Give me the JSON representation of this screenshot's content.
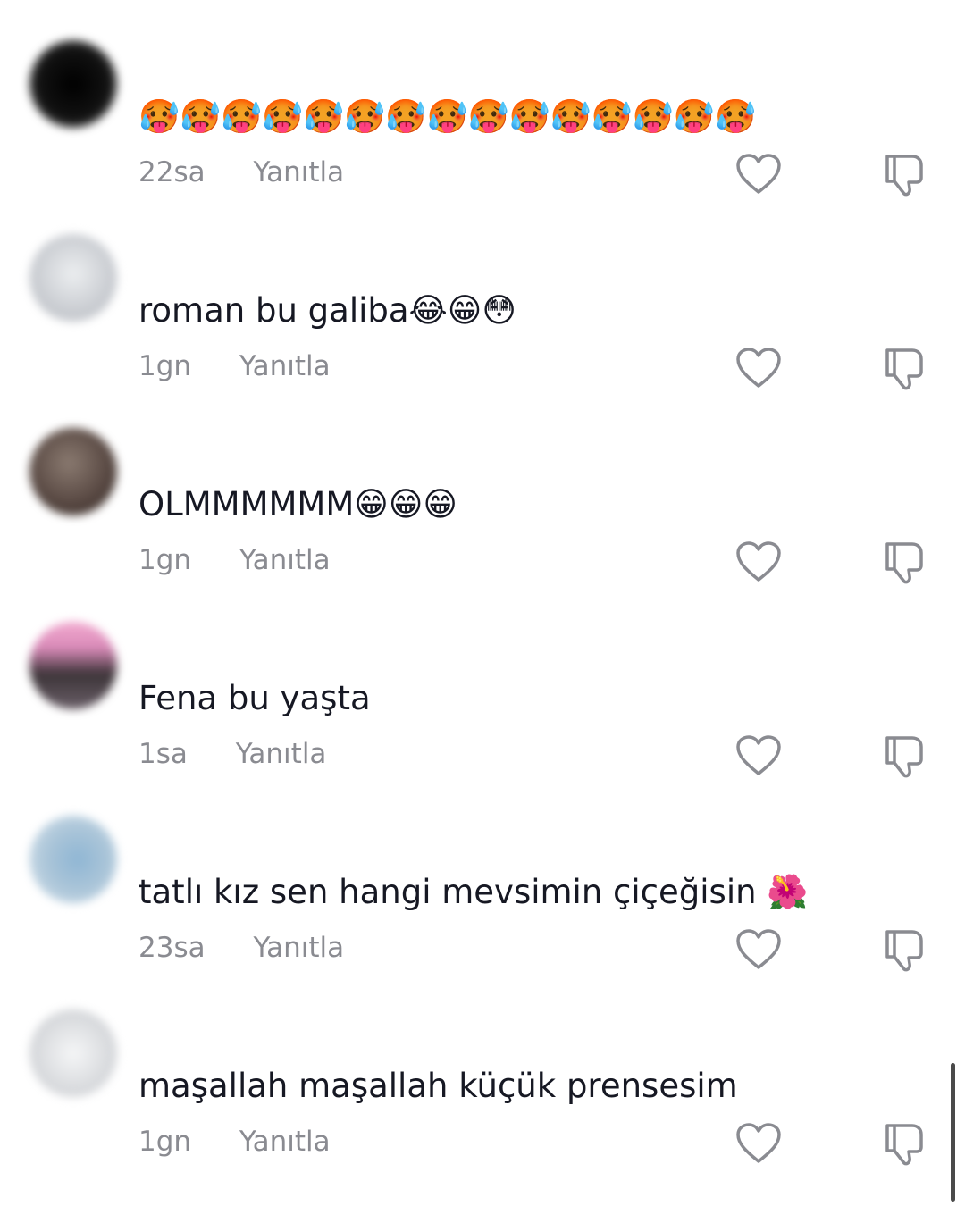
{
  "comments": [
    {
      "text": "🥵🥵🥵🥵🥵🥵🥵🥵🥵🥵🥵🥵🥵🥵🥵",
      "time": "22sa",
      "reply": "Yanıtla",
      "avatar_color": "#111111"
    },
    {
      "text": "roman bu galiba😂😁😳",
      "time": "1gn",
      "reply": "Yanıtla",
      "avatar_color": "#c9ccd1"
    },
    {
      "text": "OLMMMMMM😁😁😁",
      "time": "1gn",
      "reply": "Yanıtla",
      "avatar_color": "#5a4a44"
    },
    {
      "text": "Fena bu yaşta",
      "time": "1sa",
      "reply": "Yanıtla",
      "avatar_color": "#7a6a76"
    },
    {
      "text": "tatlı kız sen hangi mevsimin çiçeğisin 🌺",
      "time": "23sa",
      "reply": "Yanıtla",
      "avatar_color": "#a9c4d8"
    },
    {
      "text": "maşallah maşallah küçük prensesim",
      "time": "1gn",
      "reply": "Yanıtla",
      "avatar_color": "#d8dadd"
    }
  ],
  "icons": {
    "like": "heart-outline-icon",
    "dislike": "thumbs-down-outline-icon"
  },
  "colors": {
    "text": "#161823",
    "meta": "#8a8b91",
    "icon": "#8a8b91"
  }
}
